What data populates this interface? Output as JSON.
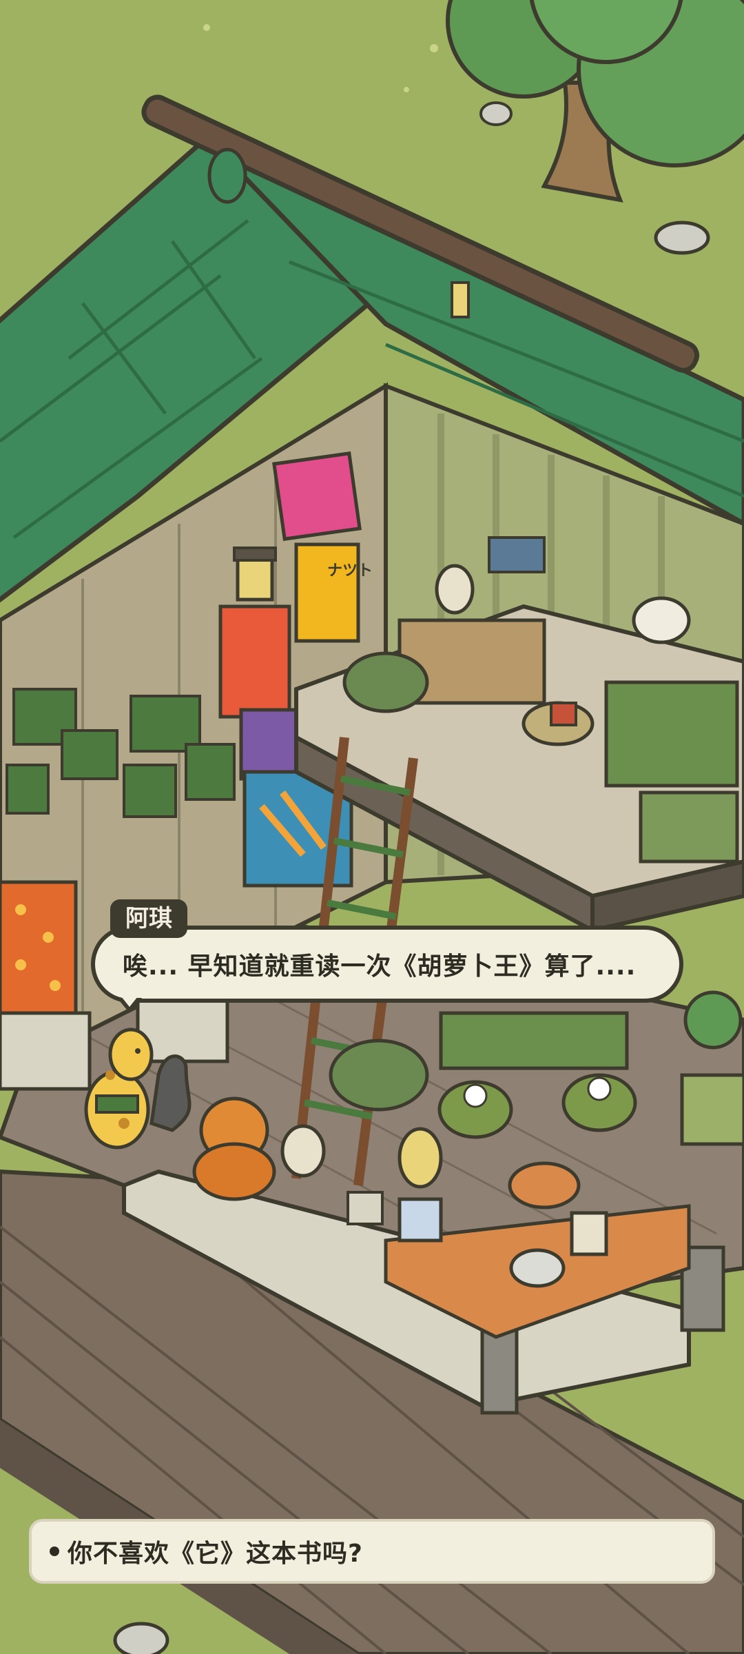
{
  "dialogue": {
    "speaker": "阿琪",
    "line": "唉... 早知道就重读一次《胡萝卜王》算了...."
  },
  "choices": [
    {
      "text": "你不喜欢《它》这本书吗?"
    }
  ],
  "poster": {
    "label": "ナツト"
  },
  "colors": {
    "grass": "#9fb262",
    "roof": "#3f8a5c",
    "wood_floor": "#8a7b6a",
    "bubble_bg": "#f3efdf",
    "bubble_border": "#3d3a2e"
  }
}
